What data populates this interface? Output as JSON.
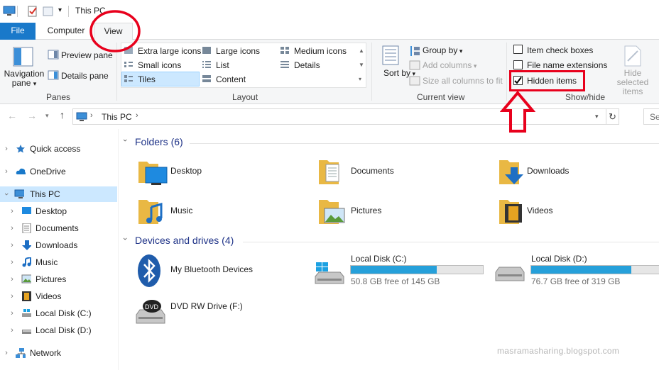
{
  "window": {
    "title": "This PC"
  },
  "tabs": {
    "file": "File",
    "computer": "Computer",
    "view": "View"
  },
  "ribbon": {
    "panes": {
      "navigation_pane": "Navigation pane",
      "preview_pane": "Preview pane",
      "details_pane": "Details pane",
      "group": "Panes"
    },
    "layout": {
      "extra_large_icons": "Extra large icons",
      "large_icons": "Large icons",
      "medium_icons": "Medium icons",
      "small_icons": "Small icons",
      "list": "List",
      "details": "Details",
      "tiles": "Tiles",
      "content": "Content",
      "group": "Layout"
    },
    "current_view": {
      "sort_by": "Sort by",
      "group_by": "Group by",
      "add_columns": "Add columns",
      "size_all_columns": "Size all columns to fit",
      "group": "Current view"
    },
    "show_hide": {
      "item_check_boxes": "Item check boxes",
      "file_name_extensions": "File name extensions",
      "hidden_items": "Hidden items",
      "hide_selected_items": "Hide selected items",
      "group": "Show/hide",
      "hidden_items_checked": true
    }
  },
  "address": {
    "path": "This PC",
    "search_placeholder": "Se"
  },
  "nav": {
    "items": [
      {
        "label": "Quick access"
      },
      {
        "label": "OneDrive"
      },
      {
        "label": "This PC"
      },
      {
        "label": "Desktop"
      },
      {
        "label": "Documents"
      },
      {
        "label": "Downloads"
      },
      {
        "label": "Music"
      },
      {
        "label": "Pictures"
      },
      {
        "label": "Videos"
      },
      {
        "label": "Local Disk (C:)"
      },
      {
        "label": "Local Disk (D:)"
      },
      {
        "label": "Network"
      }
    ]
  },
  "content": {
    "folders_title": "Folders (6)",
    "folders": [
      {
        "name": "Desktop",
        "icon": "desktop-folder-icon"
      },
      {
        "name": "Documents",
        "icon": "documents-folder-icon"
      },
      {
        "name": "Downloads",
        "icon": "downloads-folder-icon"
      },
      {
        "name": "Music",
        "icon": "music-folder-icon"
      },
      {
        "name": "Pictures",
        "icon": "pictures-folder-icon"
      },
      {
        "name": "Videos",
        "icon": "videos-folder-icon"
      }
    ],
    "devices_title": "Devices and drives (4)",
    "devices": [
      {
        "name": "My Bluetooth Devices",
        "icon": "bluetooth-icon"
      },
      {
        "name": "Local Disk (C:)",
        "free": "50.8 GB free of 145 GB",
        "used_fraction": 0.65
      },
      {
        "name": "Local Disk (D:)",
        "free": "76.7 GB free of 319 GB",
        "used_fraction": 0.76
      },
      {
        "name": "DVD RW Drive (F:)",
        "icon": "dvd-drive-icon"
      }
    ]
  },
  "watermark": "masramasharing.blogspot.com",
  "colors": {
    "accent": "#1979ca",
    "highlight": "#e8001c",
    "selection": "#cce8ff",
    "drive_bar": "#26a0da",
    "section_title": "#1e3287"
  }
}
